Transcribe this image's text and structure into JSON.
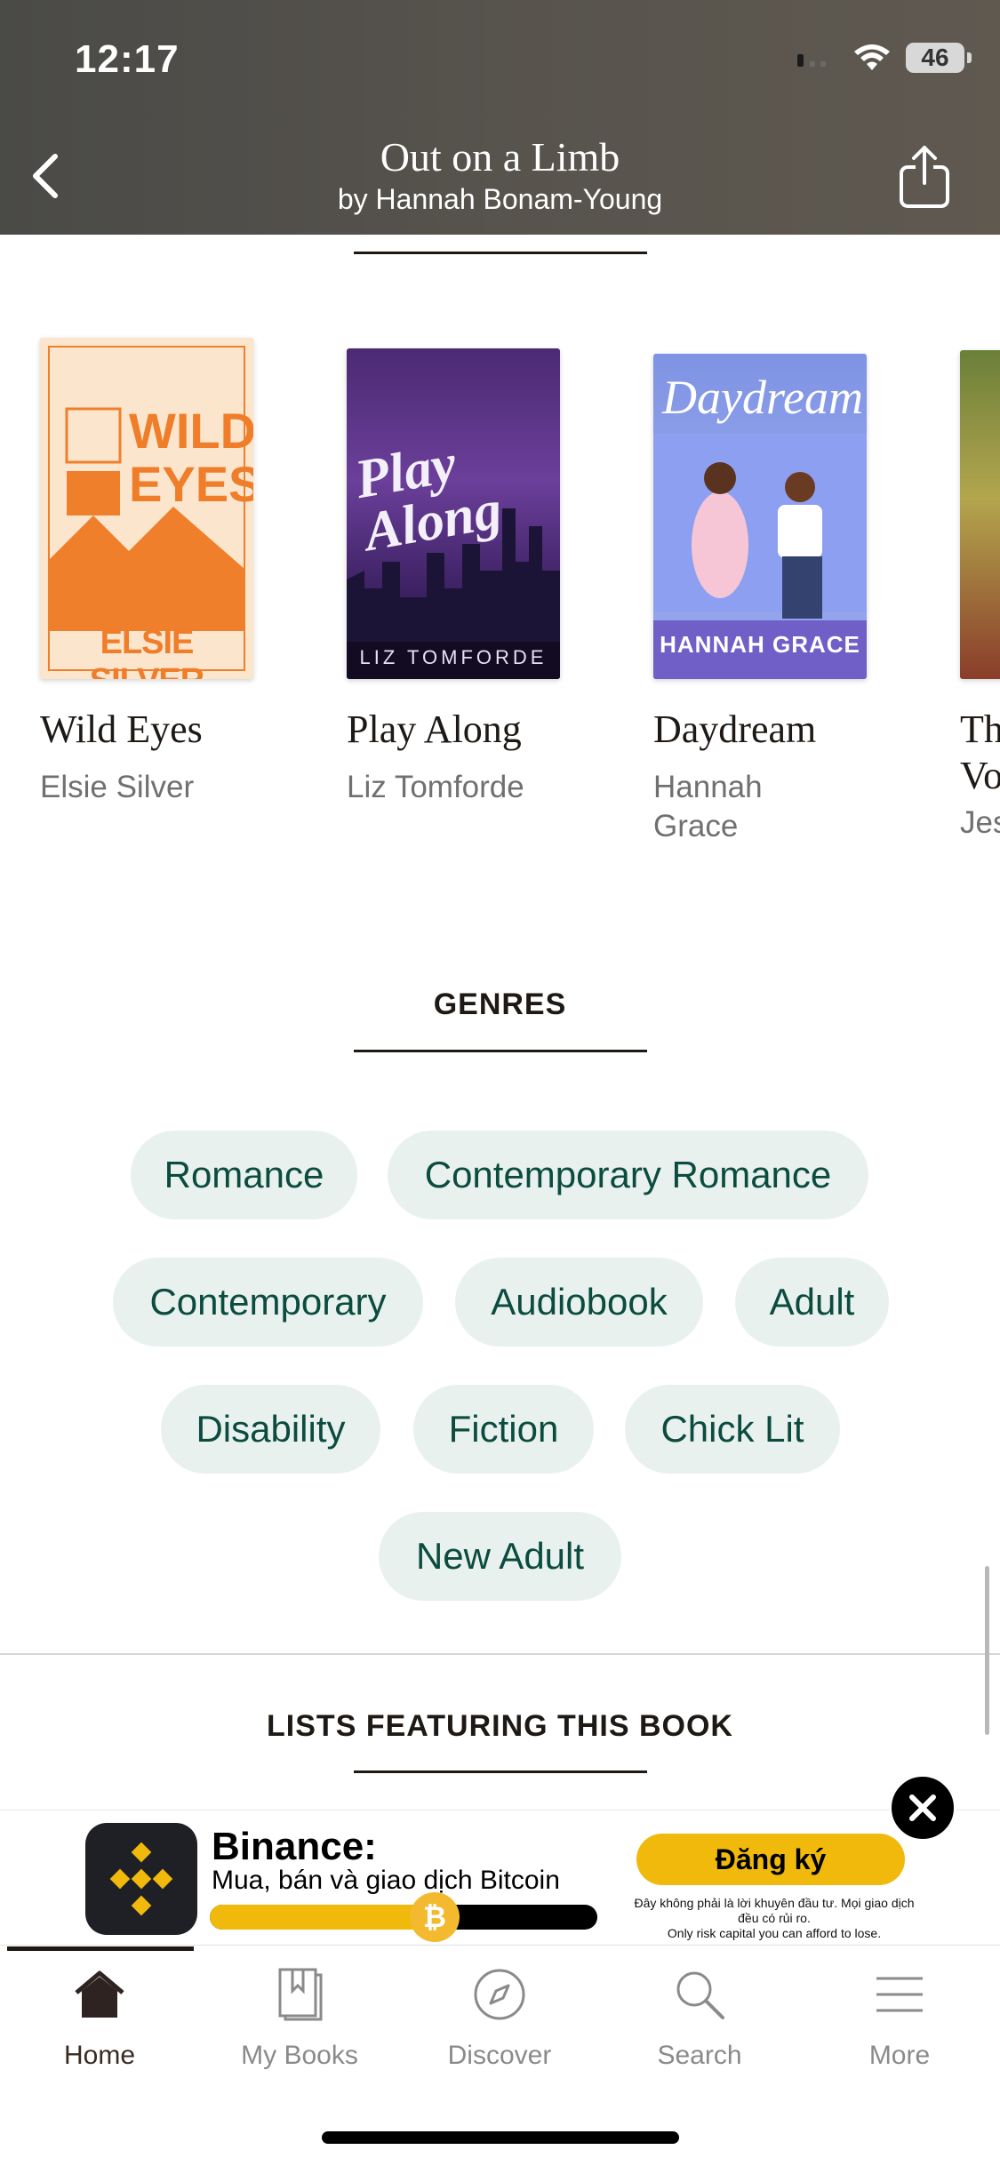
{
  "status": {
    "time": "12:17",
    "battery": "46"
  },
  "header": {
    "title": "Out on a Limb",
    "subtitle": "by Hannah Bonam-Young"
  },
  "books": [
    {
      "title": "Wild Eyes",
      "author": "Elsie Silver",
      "cover_text_1": "WILD",
      "cover_text_2": "EYES",
      "cover_author": "ELSIE SILVER"
    },
    {
      "title": "Play Along",
      "author": "Liz Tomforde",
      "cover_text_1": "Play Along",
      "cover_author": "LIZ TOMFORDE"
    },
    {
      "title": "Daydream",
      "author": "Hannah Grace",
      "cover_text_1": "Daydream",
      "cover_author": "HANNAH GRACE"
    },
    {
      "title": "Th Vo",
      "author": "Jes"
    }
  ],
  "genres": {
    "heading": "GENRES",
    "items": [
      "Romance",
      "Contemporary Romance",
      "Contemporary",
      "Audiobook",
      "Adult",
      "Disability",
      "Fiction",
      "Chick Lit",
      "New Adult"
    ]
  },
  "lists": {
    "heading": "LISTS FEATURING THIS BOOK"
  },
  "ad": {
    "title": "Binance:",
    "subtitle": "Mua, bán và giao dịch Bitcoin",
    "cta": "Đăng ký",
    "disclaimer_1": "Đây không phải là lời khuyên đầu tư. Mọi giao dịch đều có rủi ro.",
    "disclaimer_2": "Only risk capital you can afford to lose.",
    "progress": 0.58,
    "coin_symbol": "₿"
  },
  "tabs": [
    {
      "label": "Home",
      "icon": "home-icon",
      "active": true
    },
    {
      "label": "My Books",
      "icon": "books-icon",
      "active": false
    },
    {
      "label": "Discover",
      "icon": "compass-icon",
      "active": false
    },
    {
      "label": "Search",
      "icon": "search-icon",
      "active": false
    },
    {
      "label": "More",
      "icon": "menu-icon",
      "active": false
    }
  ],
  "colors": {
    "chip_bg": "#e9f1ef",
    "chip_text": "#0b4c3f",
    "binance_yellow": "#f0b90b"
  }
}
